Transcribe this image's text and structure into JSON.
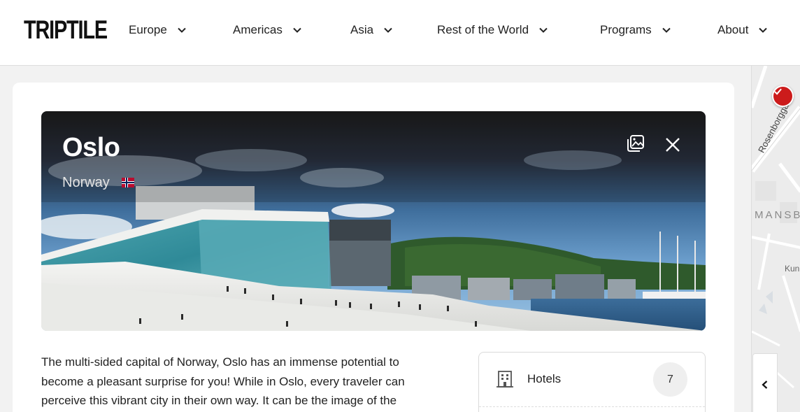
{
  "brand": {
    "logo_text": "TRIPTILE"
  },
  "nav": {
    "items": [
      {
        "label": "Europe"
      },
      {
        "label": "Americas"
      },
      {
        "label": "Asia"
      },
      {
        "label": "Rest of the World"
      },
      {
        "label": "Programs"
      },
      {
        "label": "About"
      }
    ],
    "chevron_icon": "chevron-down-icon"
  },
  "hero": {
    "city": "Oslo",
    "country": "Norway",
    "flag_icon": "norway-flag-icon",
    "gallery_icon": "image-gallery-icon",
    "close_icon": "close-icon"
  },
  "description": {
    "lines": [
      "The multi-sided capital of Norway, Oslo has an immense potential to",
      "become a pleasant surprise for you! While in Oslo, every traveler can",
      "perceive this vibrant city in their own way. It can be the image of the"
    ]
  },
  "categories": [
    {
      "label": "Hotels",
      "count": "7",
      "icon": "building-icon"
    }
  ],
  "map": {
    "street_label": "Rosenborggata",
    "district_label": "MANSBY",
    "place_label": "Kun",
    "pin_icon": "checkmark-pin-icon",
    "collapse_icon": "chevron-left-icon"
  },
  "colors": {
    "pin_red": "#cc1b1b",
    "header_bg": "#ffffff",
    "page_bg": "#f2f2f2"
  }
}
